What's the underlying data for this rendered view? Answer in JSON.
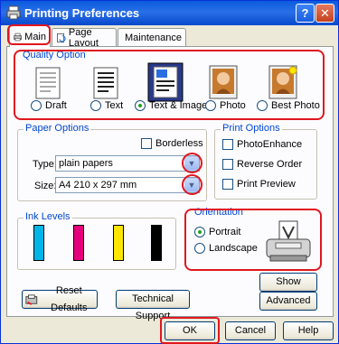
{
  "window": {
    "title": "Printing Preferences"
  },
  "titlebar_buttons": {
    "help": "?",
    "close": "✕"
  },
  "tabs": [
    {
      "label": "Main",
      "icon": "printer-icon",
      "active": true
    },
    {
      "label": "Page Layout",
      "icon": "page-layout-icon",
      "active": false
    },
    {
      "label": "Maintenance",
      "icon": "maintenance-icon",
      "active": false
    }
  ],
  "quality": {
    "title": "Quality Option",
    "options": [
      {
        "label": "Draft",
        "selected": false
      },
      {
        "label": "Text",
        "selected": false
      },
      {
        "label": "Text & Image",
        "selected": true
      },
      {
        "label": "Photo",
        "selected": false
      },
      {
        "label": "Best Photo",
        "selected": false
      }
    ]
  },
  "paper": {
    "title": "Paper Options",
    "borderless": "Borderless",
    "type_label": "Type:",
    "type_value": "plain papers",
    "size_label": "Size:",
    "size_value": "A4 210 x 297 mm"
  },
  "print_options": {
    "title": "Print Options",
    "photo_enhance": "PhotoEnhance",
    "reverse_order": "Reverse Order",
    "print_preview": "Print Preview"
  },
  "ink": {
    "title": "Ink Levels",
    "levels": [
      {
        "color": "#00b6e8",
        "fraction": 1.0
      },
      {
        "color": "#e6007e",
        "fraction": 1.0
      },
      {
        "color": "#ffe600",
        "fraction": 1.0
      },
      {
        "color": "#000000",
        "fraction": 1.0
      }
    ]
  },
  "orientation": {
    "title": "Orientation",
    "portrait": "Portrait",
    "landscape": "Landscape",
    "selected": "portrait"
  },
  "buttons": {
    "show_settings": "Show Settings",
    "reset_defaults": "Reset Defaults",
    "technical_support": "Technical Support",
    "advanced": "Advanced",
    "ok": "OK",
    "cancel": "Cancel",
    "help": "Help"
  },
  "colors": {
    "highlight": "#e0171f",
    "group_title": "#0046d5"
  }
}
